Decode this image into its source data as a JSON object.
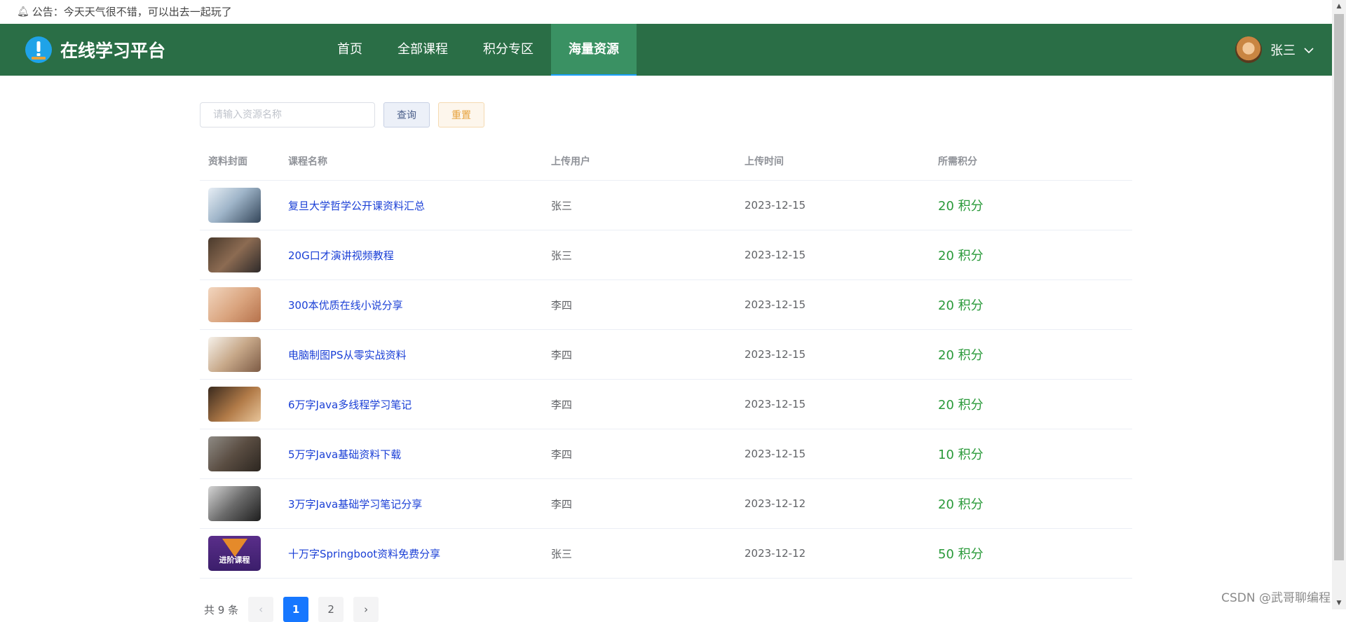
{
  "notice": {
    "text": "公告：今天天气很不错，可以出去一起玩了",
    "icon": "bell-icon"
  },
  "header": {
    "brand_title": "在线学习平台",
    "nav": [
      {
        "label": "首页"
      },
      {
        "label": "全部课程"
      },
      {
        "label": "积分专区"
      },
      {
        "label": "海量资源",
        "active": true
      }
    ],
    "user": {
      "name": "张三",
      "icon": "chevron-down-icon"
    },
    "colors": {
      "navbar": "#2a6e46",
      "active_tab": "#3a9163",
      "active_underline": "#1aa0ff"
    }
  },
  "search": {
    "placeholder": "请输入资源名称",
    "value": "",
    "query_label": "查询",
    "reset_label": "重置"
  },
  "table": {
    "headers": [
      "资料封面",
      "课程名称",
      "上传用户",
      "上传时间",
      "所需积分"
    ],
    "rows": [
      {
        "name": "复旦大学哲学公开课资料汇总",
        "user": "张三",
        "time": "2023-12-15",
        "points": "20 积分"
      },
      {
        "name": "20G口才演讲视频教程",
        "user": "张三",
        "time": "2023-12-15",
        "points": "20 积分"
      },
      {
        "name": "300本优质在线小说分享",
        "user": "李四",
        "time": "2023-12-15",
        "points": "20 积分"
      },
      {
        "name": "电脑制图PS从零实战资料",
        "user": "李四",
        "time": "2023-12-15",
        "points": "20 积分"
      },
      {
        "name": "6万字Java多线程学习笔记",
        "user": "李四",
        "time": "2023-12-15",
        "points": "20 积分"
      },
      {
        "name": "5万字Java基础资料下载",
        "user": "李四",
        "time": "2023-12-15",
        "points": "10 积分"
      },
      {
        "name": "3万字Java基础学习笔记分享",
        "user": "李四",
        "time": "2023-12-12",
        "points": "20 积分"
      },
      {
        "name": "十万字Springboot资料免费分享",
        "user": "张三",
        "time": "2023-12-12",
        "points": "50 积分",
        "cover_text": "进阶课程"
      }
    ],
    "colors": {
      "link": "#1a3fd6",
      "points": "#2a9a3a"
    }
  },
  "pagination": {
    "total_text": "共 9 条",
    "prev": "‹",
    "next": "›",
    "pages": [
      "1",
      "2"
    ],
    "current": "1",
    "active_color": "#1677ff"
  },
  "watermark": "CSDN @武哥聊编程"
}
